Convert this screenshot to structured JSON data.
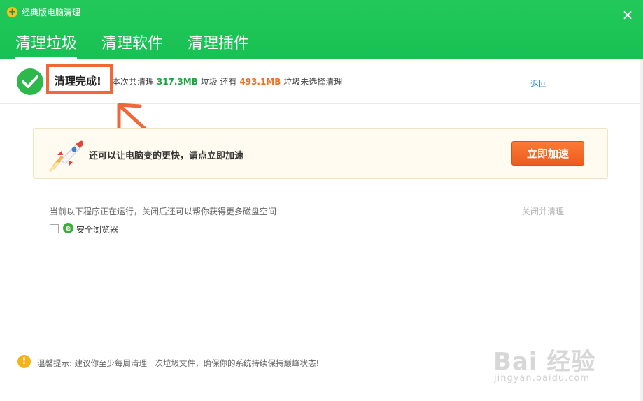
{
  "window": {
    "title": "经典版电脑清理",
    "close_icon": "×"
  },
  "nav": {
    "tabs": [
      {
        "label": "清理垃圾",
        "active": true
      },
      {
        "label": "清理软件",
        "active": false
      },
      {
        "label": "清理插件",
        "active": false
      }
    ]
  },
  "result": {
    "done_label": "清理完成!",
    "summary_prefix": "本次共清理",
    "cleaned_size": "317.3MB",
    "summary_mid1": "垃圾 还有",
    "remaining_size": "493.1MB",
    "summary_suffix": "垃圾未选择清理",
    "back_label": "返回"
  },
  "speed": {
    "message": "还可以让电脑变的更快，请点立即加速",
    "button_label": "立即加速"
  },
  "running": {
    "title": "当前以下程序正在运行，关闭后还可以帮你获得更多磁盘空间",
    "close_clean_label": "关闭并清理",
    "programs": [
      {
        "name": "安全浏览器",
        "checked": false
      }
    ]
  },
  "tip": {
    "text": "温馨提示: 建议你至少每周清理一次垃圾文件，确保你的系统持续保持巅峰状态!"
  },
  "watermark": {
    "main": "Bai 经验",
    "sub": "jingyan.baidu.com"
  },
  "colors": {
    "header_green": "#1fc455",
    "accent_orange": "#f07021",
    "cleaned_green": "#19a53f",
    "link_blue": "#2b7fd6"
  }
}
